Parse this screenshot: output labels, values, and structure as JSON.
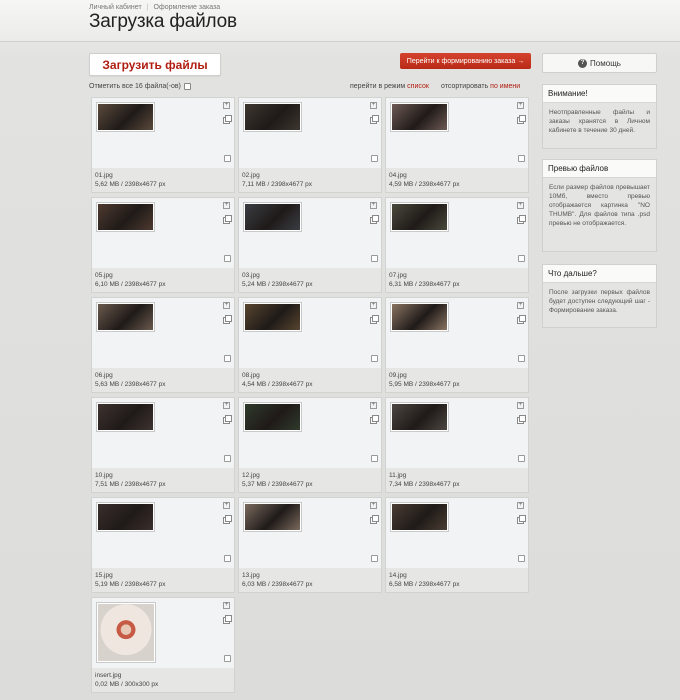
{
  "header": {
    "breadcrumb": [
      "Личный кабинет",
      "Оформление заказа"
    ],
    "title": "Загрузка файлов"
  },
  "toolbar": {
    "upload_label": "Загрузить файлы",
    "order_label": "Перейти к формированию заказа →",
    "select_all_label": "Отметить все 16 файла(-ов)",
    "view_prefix": "перейти в режим",
    "view_link": "список",
    "sort_prefix": "отсортировать",
    "sort_link": "по имени"
  },
  "files": [
    {
      "name": "01.jpg",
      "meta": "5,62 MB  /  2398x4677 px",
      "thumb_color": "#5b4a3c"
    },
    {
      "name": "02.jpg",
      "meta": "7,11 MB  /  2398x4677 px",
      "thumb_color": "#3d3630"
    },
    {
      "name": "04.jpg",
      "meta": "4,59 MB  /  2398x4677 px",
      "thumb_color": "#6e5a55"
    },
    {
      "name": "05.jpg",
      "meta": "6,10 MB  /  2398x4677 px",
      "thumb_color": "#4e3a30"
    },
    {
      "name": "03.jpg",
      "meta": "5,24 MB  /  2398x4677 px",
      "thumb_color": "#3a3d44"
    },
    {
      "name": "07.jpg",
      "meta": "6,31 MB  /  2398x4677 px",
      "thumb_color": "#4a4a3c"
    },
    {
      "name": "06.jpg",
      "meta": "5,63 MB  /  2398x4677 px",
      "thumb_color": "#6a5a4e"
    },
    {
      "name": "08.jpg",
      "meta": "4,54 MB  /  2398x4677 px",
      "thumb_color": "#57452f"
    },
    {
      "name": "09.jpg",
      "meta": "5,95 MB  /  2398x4677 px",
      "thumb_color": "#8a7462"
    },
    {
      "name": "10.jpg",
      "meta": "7,51 MB  /  2398x4677 px",
      "thumb_color": "#3e3330"
    },
    {
      "name": "12.jpg",
      "meta": "5,37 MB  /  2398x4677 px",
      "thumb_color": "#2f3a2c"
    },
    {
      "name": "11.jpg",
      "meta": "7,34 MB  /  2398x4677 px",
      "thumb_color": "#4c4741"
    },
    {
      "name": "15.jpg",
      "meta": "5,19 MB  /  2398x4677 px",
      "thumb_color": "#3a2f2c"
    },
    {
      "name": "13.jpg",
      "meta": "6,03 MB  /  2398x4677 px",
      "thumb_color": "#7a6a5e"
    },
    {
      "name": "14.jpg",
      "meta": "6,58 MB  /  2398x4677 px",
      "thumb_color": "#4a3d33"
    },
    {
      "name": "insert.jpg",
      "meta": "0,02 MB  /  300x300 px",
      "thumb_color": "#d9cfc8"
    }
  ],
  "sidebar": {
    "help_label": "Помощь",
    "panels": [
      {
        "title": "Внимание!",
        "text": "Неотправленные файлы и заказы хранятся в Личном кабинете в течение 30 дней."
      },
      {
        "title": "Превью файлов",
        "text": "Если размер файлов превышает 10Мб, вместо превью отображается картинка \"NO THUMB\". Для файлов типа .psd превью не отображается."
      },
      {
        "title": "Что дальше?",
        "text": "После загрузки первых файлов будет доступен следующий шаг - Формирование заказа."
      }
    ]
  }
}
